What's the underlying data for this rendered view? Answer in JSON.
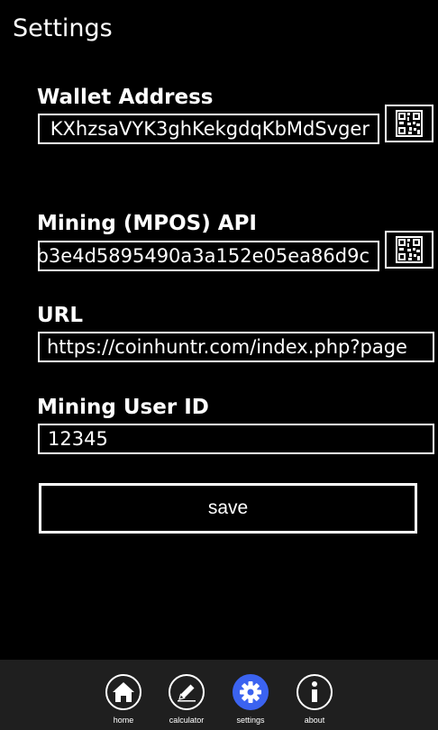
{
  "page": {
    "title": "Settings"
  },
  "wallet": {
    "label": "Wallet Address",
    "value": "KXhzsaVYK3ghKekgdqKbMdSvger"
  },
  "api": {
    "label": "Mining (MPOS) API",
    "value": "b3e4d5895490a3a152e05ea86d9c"
  },
  "url": {
    "label": "URL",
    "value": "https://coinhuntr.com/index.php?page"
  },
  "user": {
    "label": "Mining User ID",
    "value": "12345"
  },
  "save": {
    "label": "save"
  },
  "appbar": {
    "items": [
      {
        "label": "home",
        "icon": "home-icon"
      },
      {
        "label": "calculator",
        "icon": "pencil-icon"
      },
      {
        "label": "settings",
        "icon": "gear-icon",
        "active": true
      },
      {
        "label": "about",
        "icon": "info-icon"
      }
    ]
  },
  "colors": {
    "background": "#000000",
    "appbar": "#1f1f1f",
    "accent": "#3b63f0",
    "foreground": "#ffffff"
  }
}
